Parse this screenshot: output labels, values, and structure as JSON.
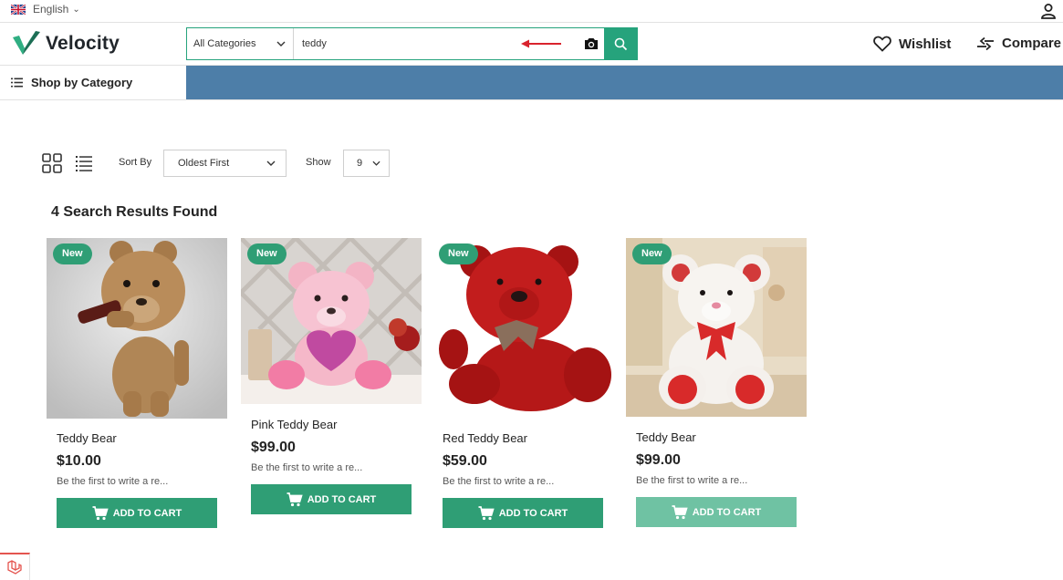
{
  "topbar": {
    "language": "English"
  },
  "header": {
    "logo_text": "Velocity",
    "search": {
      "category": "All Categories",
      "query": "teddy"
    },
    "wishlist_label": "Wishlist",
    "compare_label": "Compare"
  },
  "nav": {
    "shop_by_category": "Shop by Category"
  },
  "toolbar": {
    "sort_label": "Sort By",
    "sort_value": "Oldest First",
    "show_label": "Show",
    "show_value": "9"
  },
  "results": {
    "title": "4 Search Results Found",
    "products": [
      {
        "badge": "New",
        "name": "Teddy Bear",
        "price": "$10.00",
        "review": "Be the first to write a re...",
        "button": "ADD TO CART"
      },
      {
        "badge": "New",
        "name": "Pink Teddy Bear",
        "price": "$99.00",
        "review": "Be the first to write a re...",
        "button": "ADD TO CART"
      },
      {
        "badge": "New",
        "name": "Red Teddy Bear",
        "price": "$59.00",
        "review": "Be the first to write a re...",
        "button": "ADD TO CART"
      },
      {
        "badge": "New",
        "name": "Teddy Bear",
        "price": "$99.00",
        "review": "Be the first to write a re...",
        "button": "ADD TO CART"
      }
    ]
  },
  "colors": {
    "accent": "#2f9e75",
    "nav_strip": "#4d7ea8",
    "annotation_arrow": "#d9232d"
  }
}
